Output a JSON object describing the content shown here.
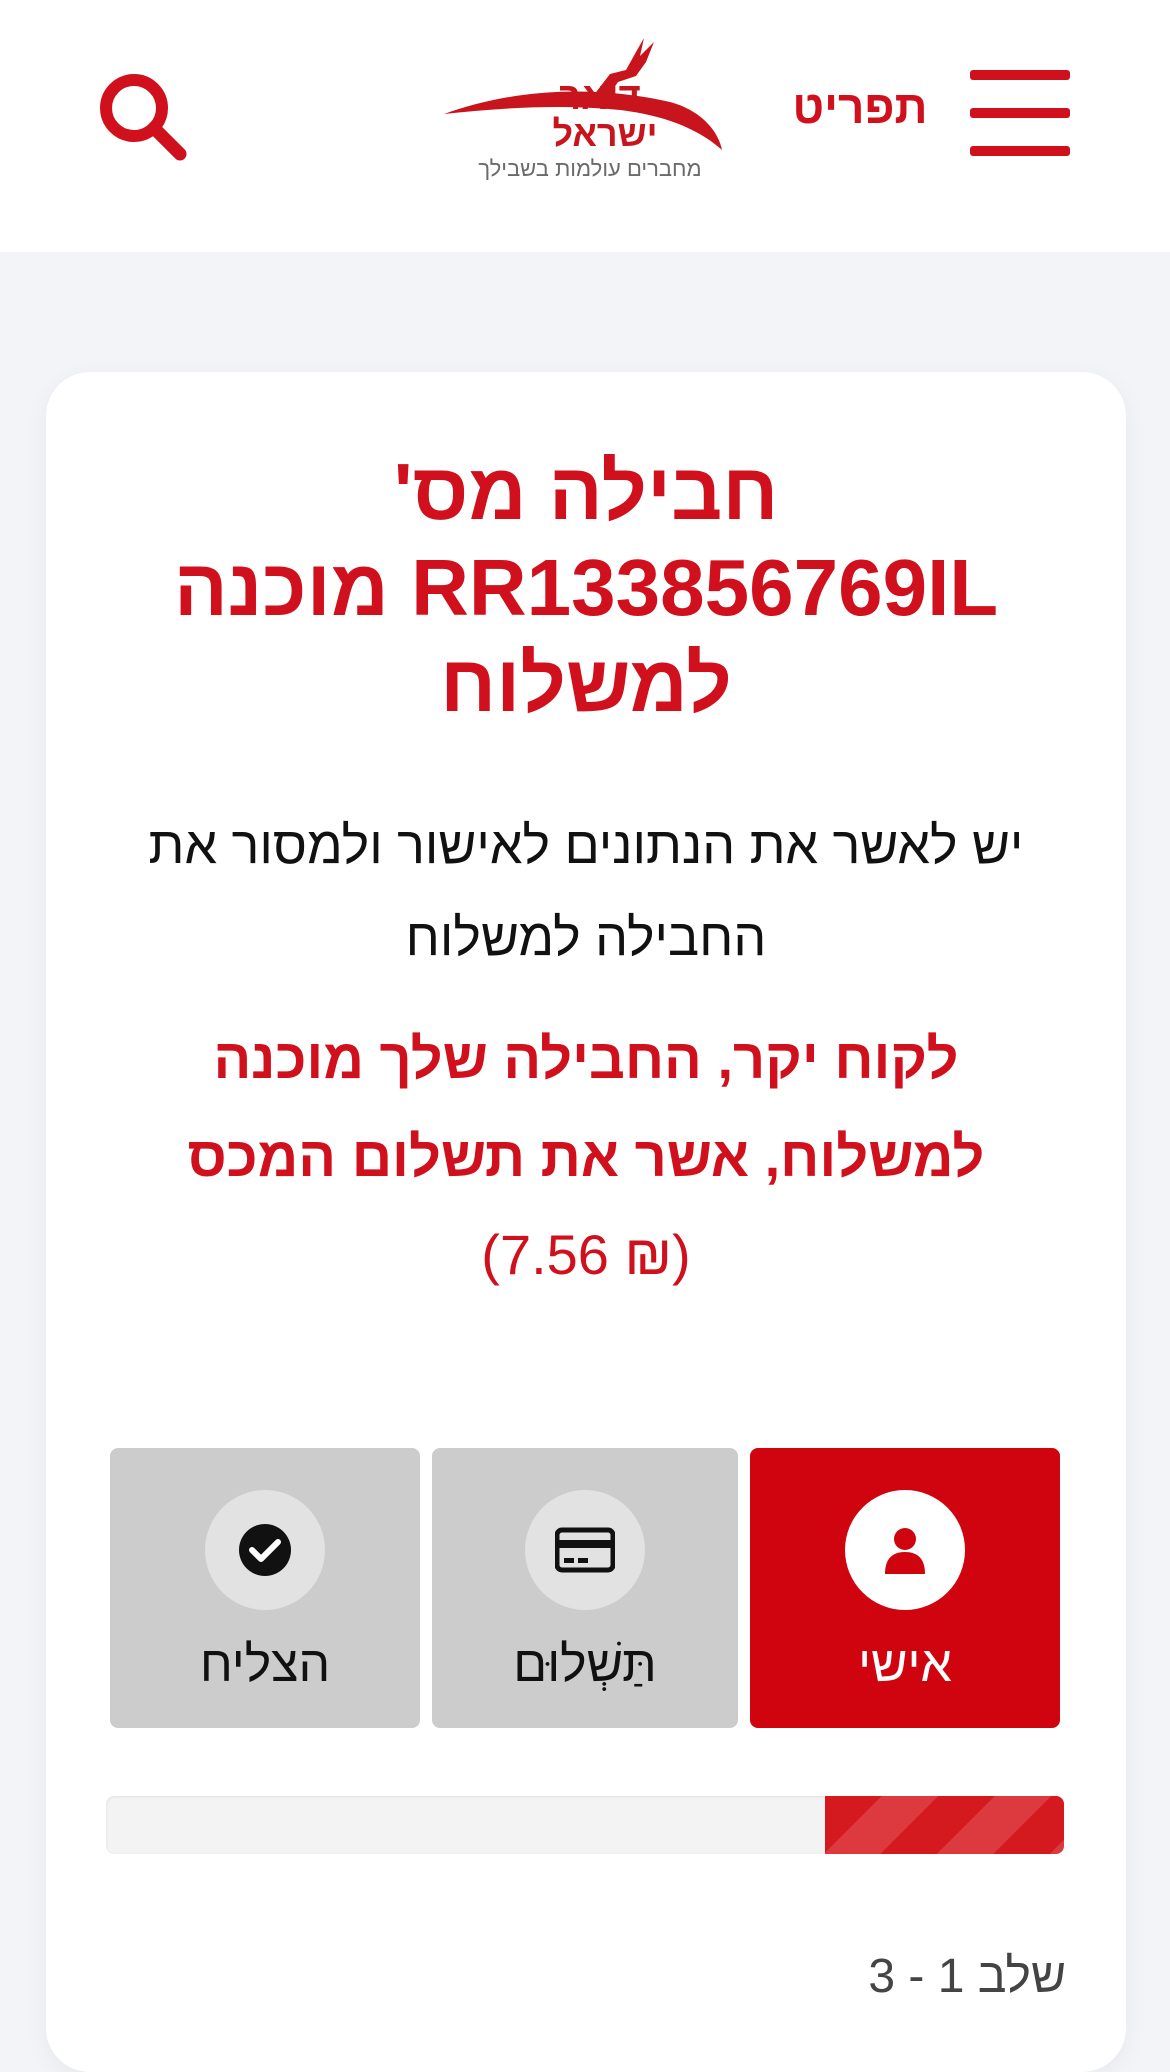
{
  "header": {
    "menu_label": "תפריט",
    "logo_line1": "דואר",
    "logo_line2": "ישראל",
    "logo_tagline": "מחברים עולמות בשבילך"
  },
  "main": {
    "title": "חבילה מס' RR133856769IL מוכנה למשלוח",
    "instruction": "יש לאשר את הנתונים לאישור ולמסור את החבילה למשלוח",
    "notice": "לקוח יקר, החבילה שלך מוכנה למשלוח, אשר את תשלום המכס",
    "notice_amount": "(₪ 7.56)"
  },
  "steps": [
    {
      "label": "אישי",
      "icon": "user-icon",
      "active": true
    },
    {
      "label": "תַּשְׁלוּם",
      "icon": "credit-card-icon",
      "active": false
    },
    {
      "label": "הצליח",
      "icon": "check-circle-icon",
      "active": false
    }
  ],
  "progress": {
    "fraction": 0.25
  },
  "step_count": "שלב 1 - 3",
  "colors": {
    "brand_red": "#d0040f",
    "inactive_gray": "#cccccc"
  }
}
